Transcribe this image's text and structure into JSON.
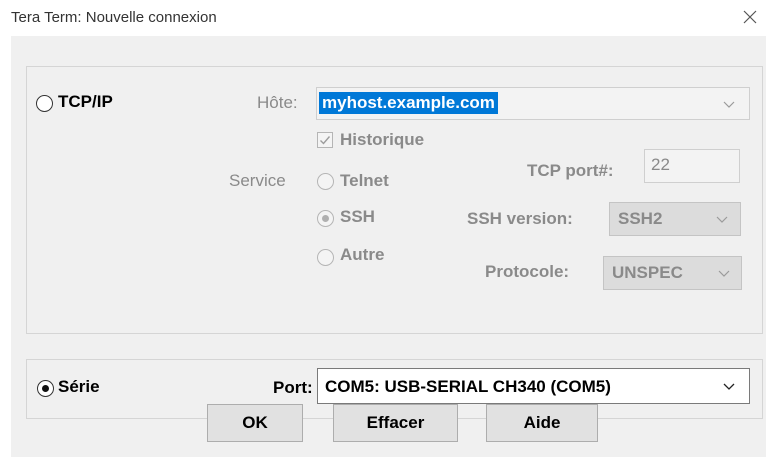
{
  "window": {
    "title": "Tera Term: Nouvelle connexion"
  },
  "tcpip": {
    "radio_label": "TCP/IP",
    "host_label": "Hôte:",
    "host_value": "myhost.example.com",
    "history_label": "Historique",
    "service_label": "Service",
    "telnet_label": "Telnet",
    "ssh_label": "SSH",
    "other_label": "Autre",
    "tcp_port_label": "TCP port#:",
    "tcp_port_value": "22",
    "ssh_version_label": "SSH version:",
    "ssh_version_value": "SSH2",
    "protocol_label": "Protocole:",
    "protocol_value": "UNSPEC"
  },
  "serial": {
    "radio_label": "Série",
    "port_label": "Port:",
    "port_value": "COM5: USB-SERIAL CH340 (COM5)"
  },
  "buttons": {
    "ok": "OK",
    "clear": "Effacer",
    "help": "Aide"
  },
  "icons": {
    "close": "close-icon",
    "dropdown": "chevron-down-icon",
    "checkbox": "checkmark-icon"
  }
}
